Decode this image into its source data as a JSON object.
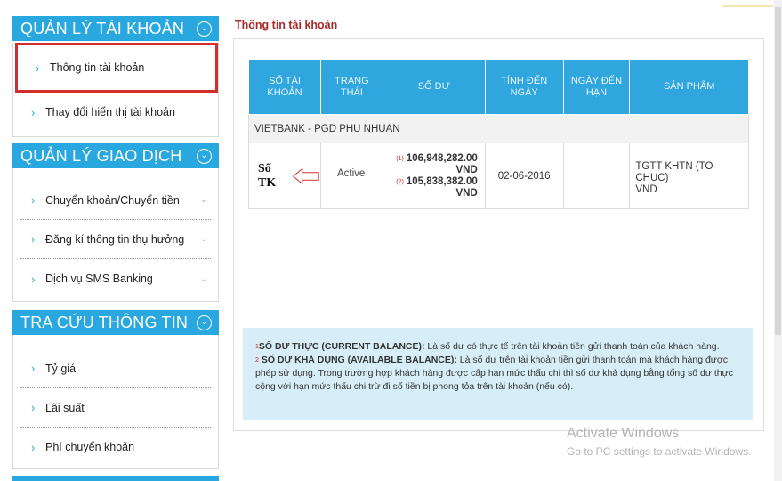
{
  "sidebar": {
    "account": {
      "title": "QUẢN LÝ TÀI KHOẢN",
      "items": [
        {
          "label": "Thông tin tài khoản"
        },
        {
          "label": "Thay đổi hiển thị tài khoản"
        }
      ]
    },
    "transactions": {
      "title": "QUẢN LÝ GIAO DỊCH",
      "items": [
        {
          "label": "Chuyển khoản/Chuyển tiền"
        },
        {
          "label": "Đăng kí thông tin thụ hưởng"
        },
        {
          "label": "Dịch vụ SMS Banking"
        }
      ]
    },
    "lookup": {
      "title": "TRA CỨU THÔNG TIN",
      "items": [
        {
          "label": "Tỷ giá"
        },
        {
          "label": "Lãi suất"
        },
        {
          "label": "Phí chuyển khoản"
        }
      ]
    }
  },
  "main": {
    "title": "Thông tin tài khoản",
    "table": {
      "headers": [
        "SỐ TÀI\nKHOẢN",
        "TRẠNG\nTHÁI",
        "SỐ DƯ",
        "TÍNH ĐẾN\nNGÀY",
        "NGÀY ĐẾN\nHẠN",
        "SẢN PHẨM"
      ],
      "branch": "VIETBANK - PGD PHU NHUAN",
      "row": {
        "account": "Số TK",
        "status": "Active",
        "balance1_marker": "(1)",
        "balance1": "106,948,282.00",
        "balance1_currency": "VND",
        "balance2_marker": "(2)",
        "balance2": "105,838,382.00",
        "balance2_currency": "VND",
        "as_of": "02-06-2016",
        "due": "",
        "product": "TGTT KHTN (TO CHUC)\nVND"
      }
    },
    "note": {
      "marker1": "1",
      "term1": "SỐ DƯ THỰC (CURRENT BALANCE):",
      "text1": " Là số dư có thực tế trên tài khoản tiền gửi thanh toán của khách hàng.",
      "marker2": "2",
      "term2": " SỐ DƯ KHẢ DỤNG (AVAILABLE BALANCE):",
      "text2": " Là số dư trên tài khoản tiền gửi thanh toán mà khách hàng được phép sử dụng. Trong trường hợp khách hàng được cấp hạn mức thấu chi thì số dư khả dụng bằng tổng số dư thực cộng với hạn mức thấu chi trừ đi số tiền bị phong tỏa trên tài khoản (nếu có)."
    }
  },
  "watermark": {
    "line1": "Activate Windows",
    "line2": "Go to PC settings to activate Windows."
  },
  "colors": {
    "accent": "#29a8e0",
    "title": "#a52a2a",
    "highlight": "#d32f2f",
    "note_bg": "#d7eef8"
  },
  "icons": {
    "collapse": "circle-chevron-down-icon",
    "item": "chevron-right-icon",
    "expand": "chevron-down-icon",
    "pointer": "left-arrow-icon"
  }
}
